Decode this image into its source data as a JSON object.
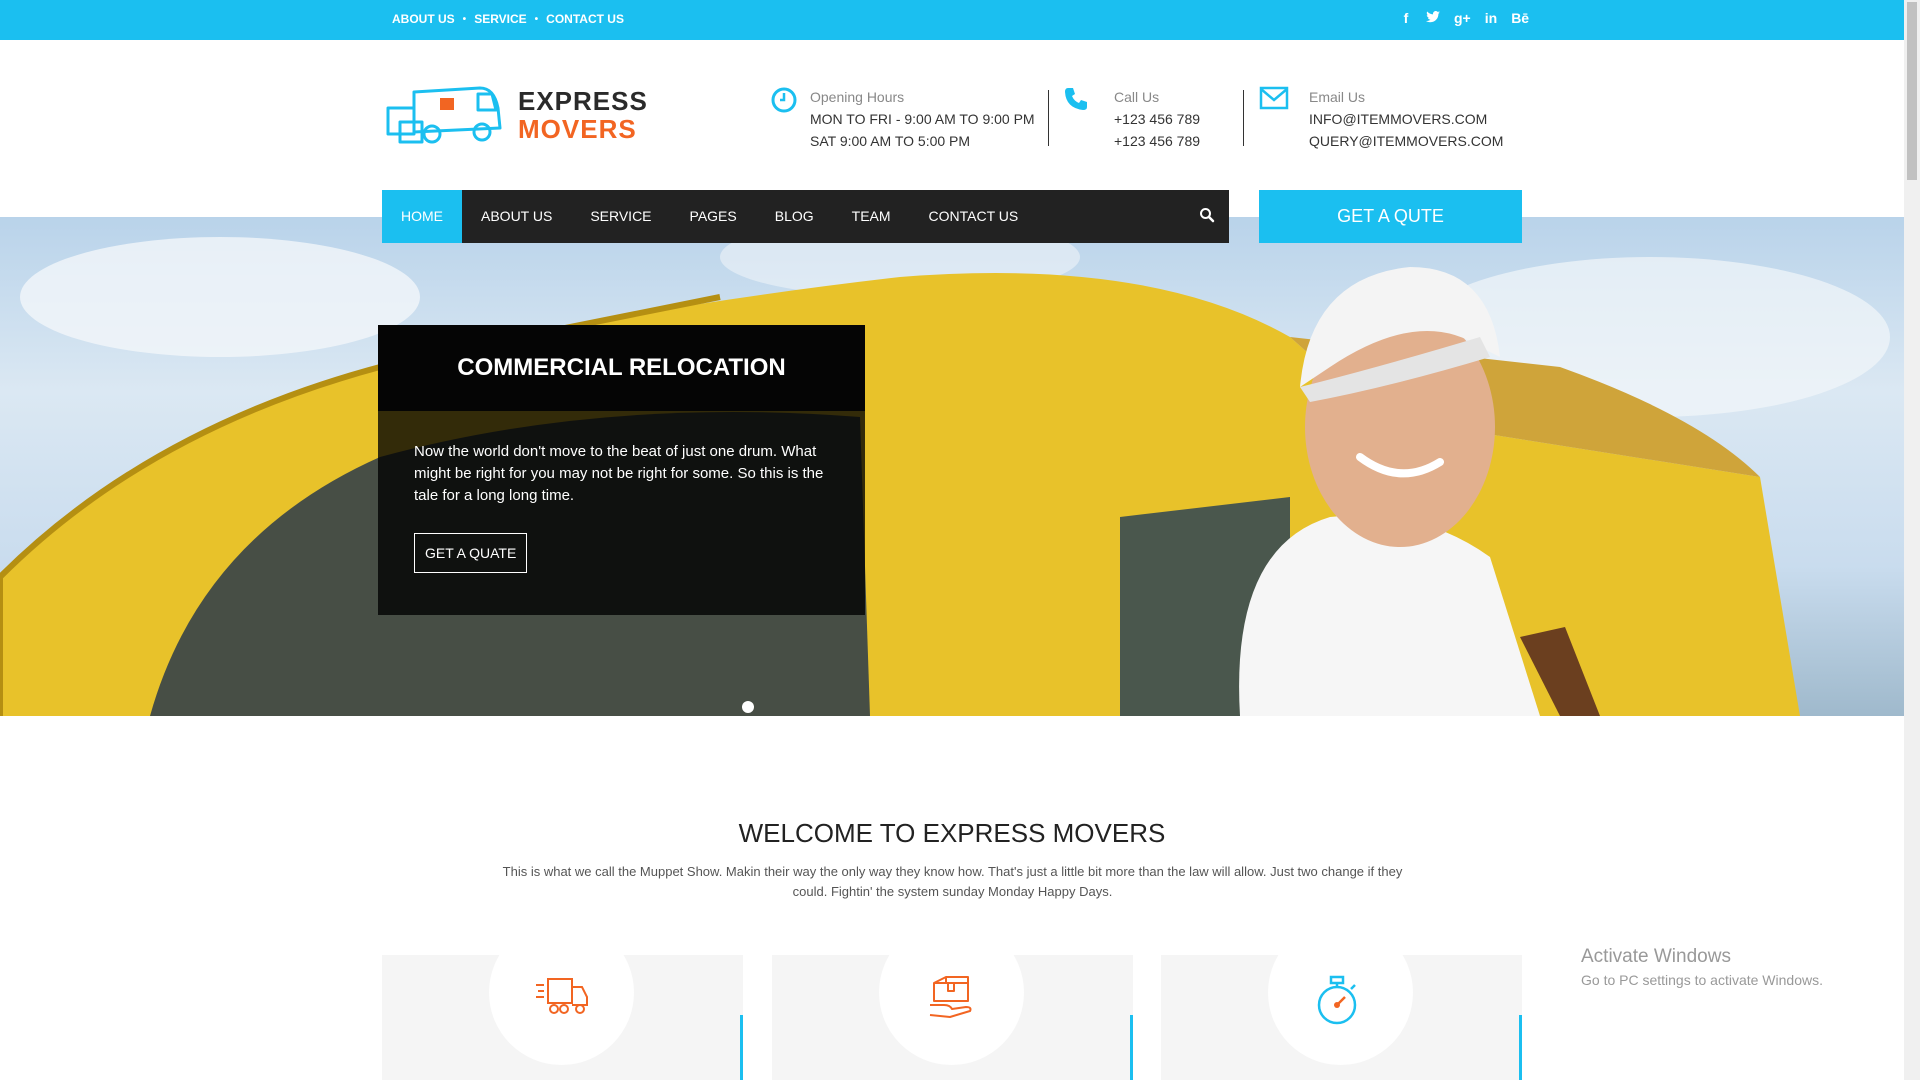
{
  "topbar": {
    "links": [
      "ABOUT US",
      "SERVICE",
      "CONTACT US"
    ],
    "social": [
      {
        "icon": "facebook-icon",
        "glyph": "f"
      },
      {
        "icon": "twitter-icon",
        "glyph": "t"
      },
      {
        "icon": "google-plus-icon",
        "glyph": "g+"
      },
      {
        "icon": "linkedin-icon",
        "glyph": "in"
      },
      {
        "icon": "behance-icon",
        "glyph": "Bē"
      }
    ]
  },
  "logo": {
    "line1": "EXPRESS",
    "line2": "MOVERS"
  },
  "info": {
    "hours": {
      "label": "Opening Hours",
      "line1": "MON TO FRI - 9:00 AM TO 9:00 PM",
      "line2": "SAT 9:00 AM TO 5:00 PM"
    },
    "call": {
      "label": "Call Us",
      "line1": "+123 456 789",
      "line2": "+123 456 789"
    },
    "email": {
      "label": "Email Us",
      "line1": "INFO@ITEMMOVERS.COM",
      "line2": "QUERY@ITEMMOVERS.COM"
    }
  },
  "nav": {
    "items": [
      "HOME",
      "ABOUT US",
      "SERVICE",
      "PAGES",
      "BLOG",
      "TEAM",
      "CONTACT US"
    ],
    "active_index": 0,
    "quote_label": "GET A QUTE"
  },
  "hero": {
    "title": "COMMERCIAL RELOCATION",
    "text": "Now the world don't move to the beat of just one drum. What might be right for you may not be right for some. So this is the tale for a long long time.",
    "button": "GET A QUATE",
    "slides": 2,
    "active_slide": 1
  },
  "welcome": {
    "title": "WELCOME TO EXPRESS MOVERS",
    "text": "This is what we call the Muppet Show. Makin their way the only way they know how. That's just a little bit more than the law will allow. Just two change if they could. Fightin' the system sunday Monday Happy Days."
  },
  "cards": [
    {
      "icon": "moving-truck-icon"
    },
    {
      "icon": "box-in-hand-icon"
    },
    {
      "icon": "stopwatch-icon"
    }
  ],
  "watermark": {
    "title": "Activate Windows",
    "subtitle": "Go to PC settings to activate Windows."
  },
  "colors": {
    "accent": "#1bbff0",
    "brand_orange": "#f26522",
    "nav_bg": "#222222"
  }
}
